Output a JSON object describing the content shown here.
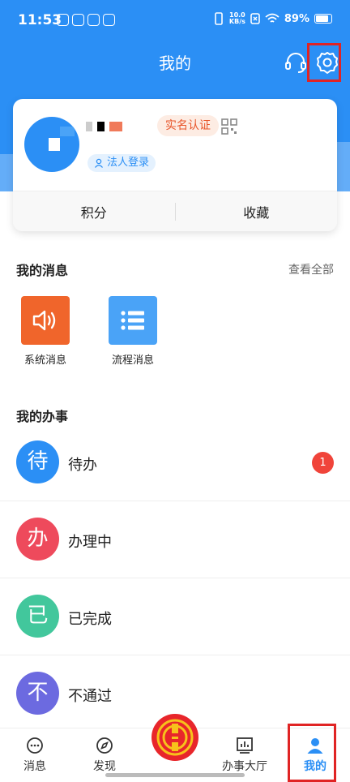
{
  "status_bar": {
    "time": "11:53",
    "speed_value": "10.0",
    "speed_unit": "KB/s",
    "battery_text": "89%"
  },
  "header": {
    "title": "我的"
  },
  "profile": {
    "verified_badge": "实名认证",
    "legal_login": "法人登录",
    "points_label": "积分",
    "favorites_label": "收藏"
  },
  "messages": {
    "title": "我的消息",
    "view_all": "查看全部",
    "items": [
      {
        "label": "系统消息",
        "icon": "speaker-icon",
        "color": "#f0652b"
      },
      {
        "label": "流程消息",
        "icon": "list-icon",
        "color": "#4aa3f7"
      }
    ]
  },
  "tasks": {
    "title": "我的办事",
    "items": [
      {
        "glyph": "待",
        "label": "待办",
        "color": "#2b8ff5",
        "badge": "1"
      },
      {
        "glyph": "办",
        "label": "办理中",
        "color": "#ee4a5c",
        "badge": ""
      },
      {
        "glyph": "已",
        "label": "已完成",
        "color": "#42c79c",
        "badge": ""
      },
      {
        "glyph": "不",
        "label": "不通过",
        "color": "#6c6ae0",
        "badge": ""
      }
    ]
  },
  "nav": {
    "items": [
      {
        "label": "消息",
        "icon": "chat-icon",
        "active": false
      },
      {
        "label": "发现",
        "icon": "compass-icon",
        "active": false
      },
      {
        "label": "办事大厅",
        "icon": "chart-icon",
        "active": false
      },
      {
        "label": "我的",
        "icon": "person-icon",
        "active": true
      }
    ],
    "center_icon": "union-logo-icon"
  },
  "colors": {
    "brand_blue": "#2b8ff5",
    "highlight_red": "#e02424"
  }
}
